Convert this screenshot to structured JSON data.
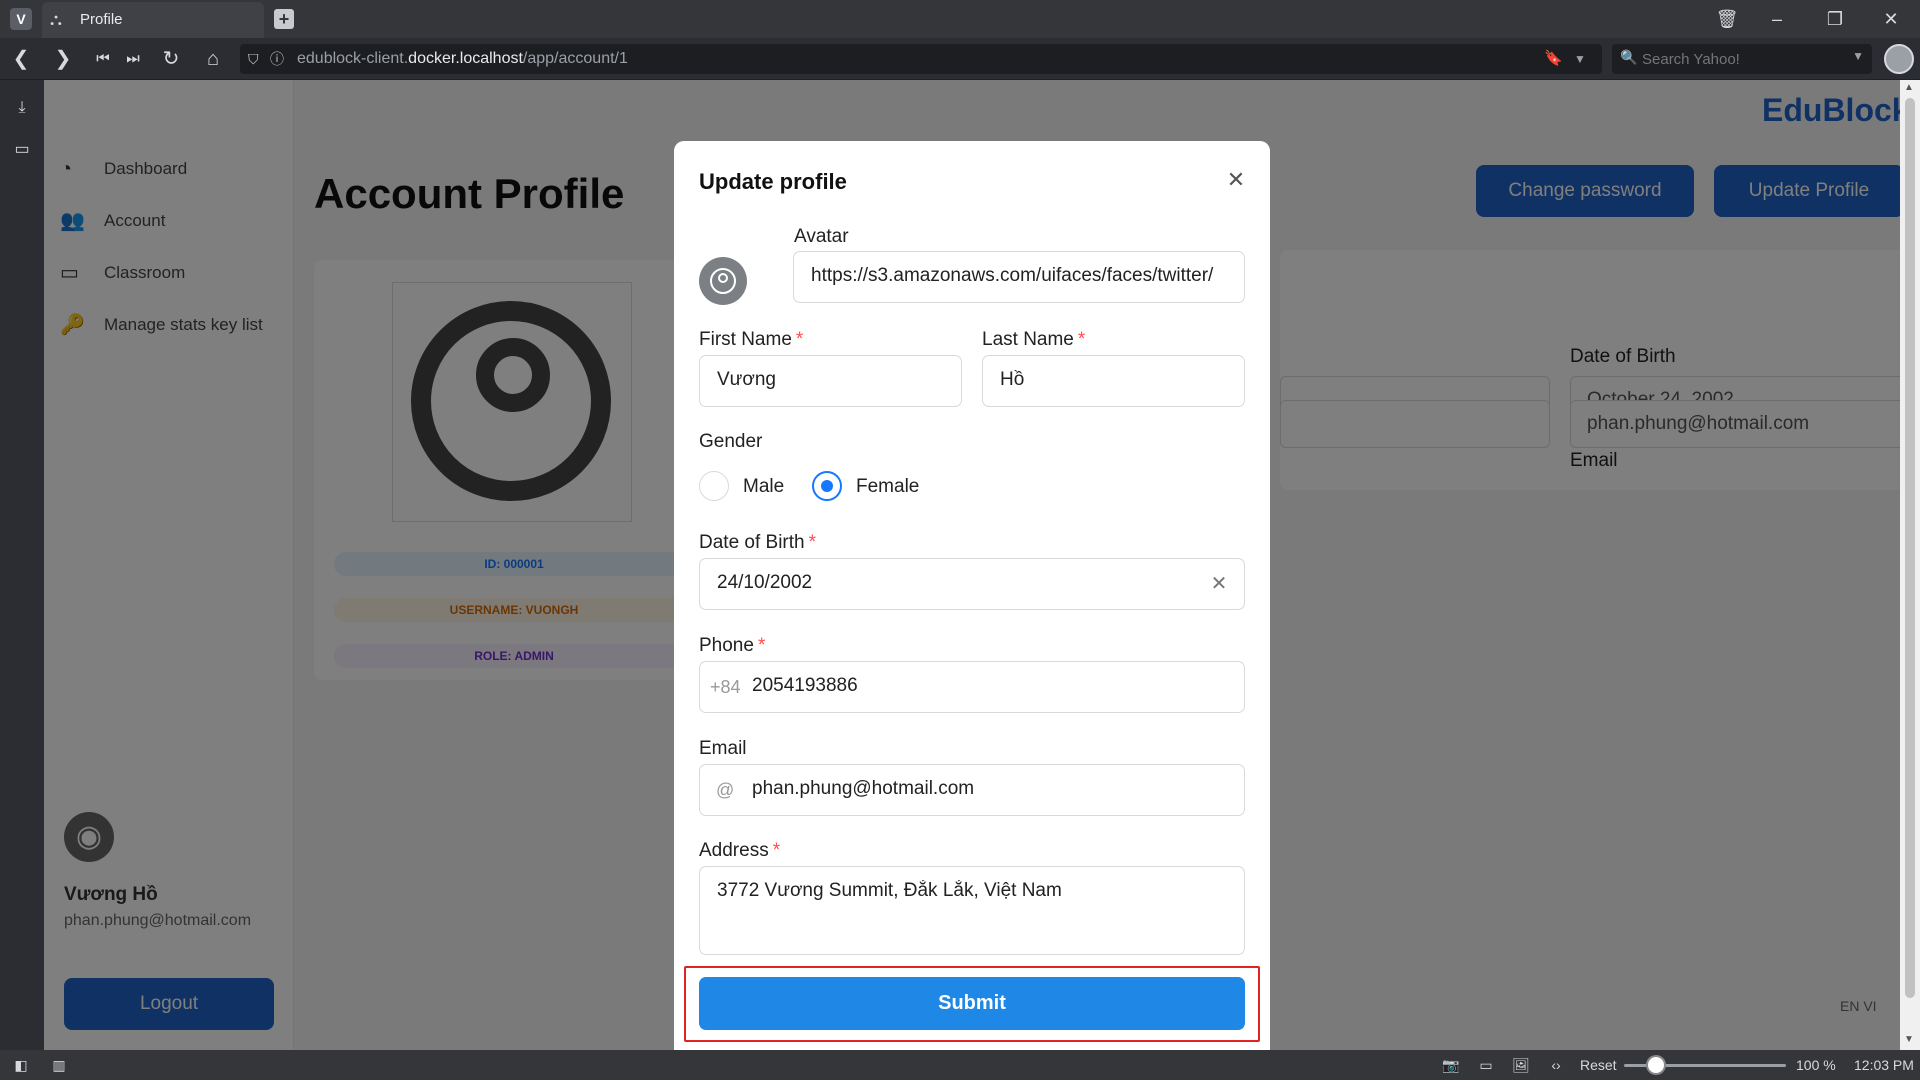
{
  "browser": {
    "tab_title": "Profile",
    "url_prefix": "edublock-client.",
    "url_host": "docker.localhost",
    "url_path": "/app/account/1",
    "search_placeholder": "Search Yahoo!",
    "zoom_reset": "Reset",
    "zoom_level": "100 %",
    "clock": "12:03 PM"
  },
  "app": {
    "brand": "EduBlock",
    "nav": [
      "Dashboard",
      "Account",
      "Classroom",
      "Manage stats key list"
    ],
    "user": {
      "name": "Vương Hồ",
      "email": "phan.phung@hotmail.com"
    },
    "logout": "Logout",
    "page_title": "Account Profile",
    "change_password": "Change password",
    "update_profile": "Update Profile",
    "tags": {
      "id": "ID: 000001",
      "username": "USERNAME: VUONGH",
      "role": "ROLE: ADMIN"
    },
    "info": {
      "dob_label": "Date of Birth",
      "dob_value": "October 24, 2002",
      "email_label": "Email",
      "email_value": "phan.phung@hotmail.com"
    },
    "lang": "EN  VI"
  },
  "modal": {
    "title": "Update profile",
    "avatar_label": "Avatar",
    "avatar_value": "https://s3.amazonaws.com/uifaces/faces/twitter/",
    "first_name_label": "First Name",
    "first_name_value": "Vương",
    "last_name_label": "Last Name",
    "last_name_value": "Hồ",
    "gender_label": "Gender",
    "gender_options": [
      "Male",
      "Female"
    ],
    "gender_selected": "Female",
    "dob_label": "Date of Birth",
    "dob_value": "24/10/2002",
    "phone_label": "Phone",
    "phone_prefix": "+84",
    "phone_value": "2054193886",
    "email_label": "Email",
    "email_prefix": "@",
    "email_value": "phan.phung@hotmail.com",
    "address_label": "Address",
    "address_value": "3772 Vương Summit, Đắk Lắk, Việt Nam",
    "submit": "Submit"
  },
  "colors": {
    "primary": "#1f87e5",
    "highlight": "#e02424",
    "required": "#ff4d4f"
  }
}
